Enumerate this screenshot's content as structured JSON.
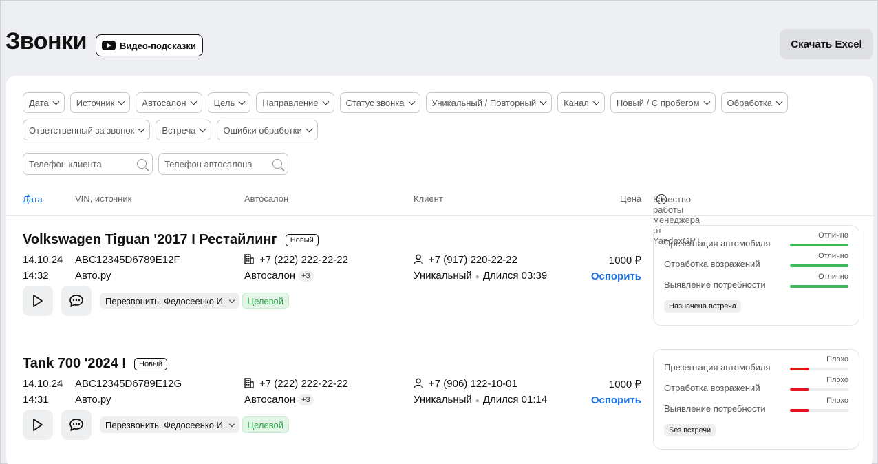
{
  "header": {
    "title": "Звонки",
    "video_button": "Видео-подсказки",
    "excel_button": "Скачать Excel"
  },
  "filters": {
    "row1": [
      "Дата",
      "Источник",
      "Автосалон",
      "Цель",
      "Направление",
      "Статус звонка",
      "Уникальный / Повторный",
      "Канал",
      "Новый / С пробегом",
      "Обработка"
    ],
    "row2": [
      "Ответственный за звонок",
      "Встреча",
      "Ошибки обработки"
    ]
  },
  "search": {
    "client_placeholder": "Телефон клиента",
    "salon_placeholder": "Телефон автосалона"
  },
  "table_header": {
    "date": "Дата",
    "vin": "VIN, источник",
    "salon": "Автосалон",
    "client": "Клиент",
    "price": "Цена",
    "quality": "Качество работы менеджера от YandexGPT",
    "info_icon": "i"
  },
  "calls": [
    {
      "car": "Volkswagen Tiguan '2017 I Рестайлинг",
      "badge": "Новый",
      "date": "14.10.24",
      "time": "14:32",
      "vin": "ABC12345D6789E12F",
      "source": "Авто.ру",
      "salon_phone": "+7 (222) 222-22-22",
      "salon": "Автосалон",
      "salon_more": "+3",
      "client_phone": "+7 (917) 220-22-22",
      "uniqueness": "Уникальный",
      "duration": "Длился 03:39",
      "price": "1000 ₽",
      "dispute": "Оспорить",
      "responsible": "Перезвонить. Федосеенко И.",
      "target": "Целевой",
      "quality": {
        "items": [
          {
            "label": "Презентация автомобиля",
            "verdict": "Отлично",
            "level": 1.0,
            "color": "#3cb95b"
          },
          {
            "label": "Отработка возражений",
            "verdict": "Отлично",
            "level": 1.0,
            "color": "#3cb95b"
          },
          {
            "label": "Выявление потребности",
            "verdict": "Отлично",
            "level": 1.0,
            "color": "#3cb95b"
          }
        ],
        "meeting": "Назначена встреча"
      }
    },
    {
      "car": "Tank 700 '2024 I",
      "badge": "Новый",
      "date": "14.10.24",
      "time": "14:31",
      "vin": "ABC12345D6789E12G",
      "source": "Авто.ру",
      "salon_phone": "+7 (222) 222-22-22",
      "salon": "Автосалон",
      "salon_more": "+3",
      "client_phone": "+7 (906) 122-10-01",
      "uniqueness": "Уникальный",
      "duration": "Длился 01:14",
      "price": "1000 ₽",
      "dispute": "Оспорить",
      "responsible": "Перезвонить. Федосеенко И.",
      "target": "Целевой",
      "quality": {
        "items": [
          {
            "label": "Презентация автомобиля",
            "verdict": "Плохо",
            "level": 0.33,
            "color": "#e5141e"
          },
          {
            "label": "Отработка возражений",
            "verdict": "Плохо",
            "level": 0.33,
            "color": "#e5141e"
          },
          {
            "label": "Выявление потребности",
            "verdict": "Плохо",
            "level": 0.33,
            "color": "#e5141e"
          }
        ],
        "meeting": "Без встречи"
      }
    }
  ]
}
